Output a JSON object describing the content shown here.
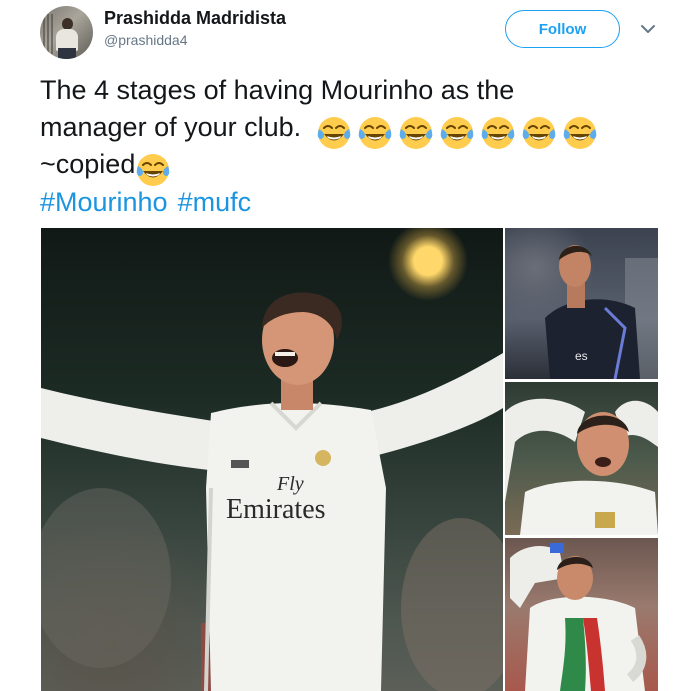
{
  "author": {
    "display_name": "Prashidda Madridista",
    "username": "@prashidda4"
  },
  "follow_button": {
    "label": "Follow"
  },
  "tweet": {
    "line1": "The 4 stages of having Mourinho as the",
    "line2": "manager of your club.",
    "line3": "~copied",
    "hashtags": [
      "#Mourinho",
      "#mufc"
    ],
    "emoji": "face-with-tears-of-joy",
    "emoji_count_line2": 7,
    "emoji_count_line3": 1
  },
  "media": {
    "main_photo": {
      "jersey_text_top": "Fly",
      "jersey_text": "Emirates"
    },
    "photo_2": {
      "jersey_text": "es"
    }
  },
  "colors": {
    "accent": "#1da1f2",
    "hashtag": "#1b95e0",
    "text": "#14171a",
    "muted": "#657786"
  }
}
